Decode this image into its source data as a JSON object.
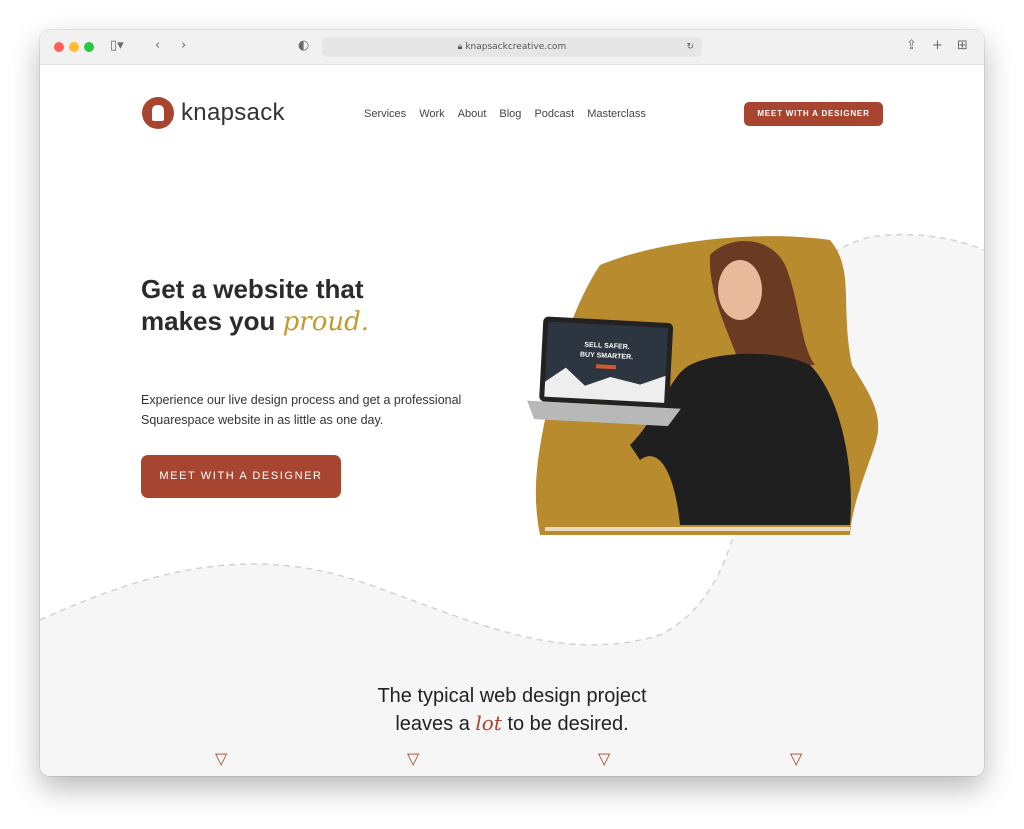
{
  "browser": {
    "url": "knapsackcreative.com"
  },
  "header": {
    "logo": "knapsack",
    "nav": [
      "Services",
      "Work",
      "About",
      "Blog",
      "Podcast",
      "Masterclass"
    ],
    "cta": "MEET WITH A DESIGNER"
  },
  "hero": {
    "title_line1": "Get a website that",
    "title_line2_a": "makes you ",
    "title_line2_em": "proud.",
    "subtitle": "Experience our live design process and get a professional Squarespace website in as little as one day.",
    "cta": "MEET WITH A DESIGNER",
    "laptop_line1": "SELL SAFER.",
    "laptop_line2": "BUY SMARTER."
  },
  "section": {
    "line1": "The typical web design project",
    "line2_a": "leaves a ",
    "line2_em": "lot",
    "line2_b": " to be desired."
  },
  "colors": {
    "brand": "#a84530",
    "gold": "#c49a2f",
    "bg_gray": "#f6f6f6"
  }
}
